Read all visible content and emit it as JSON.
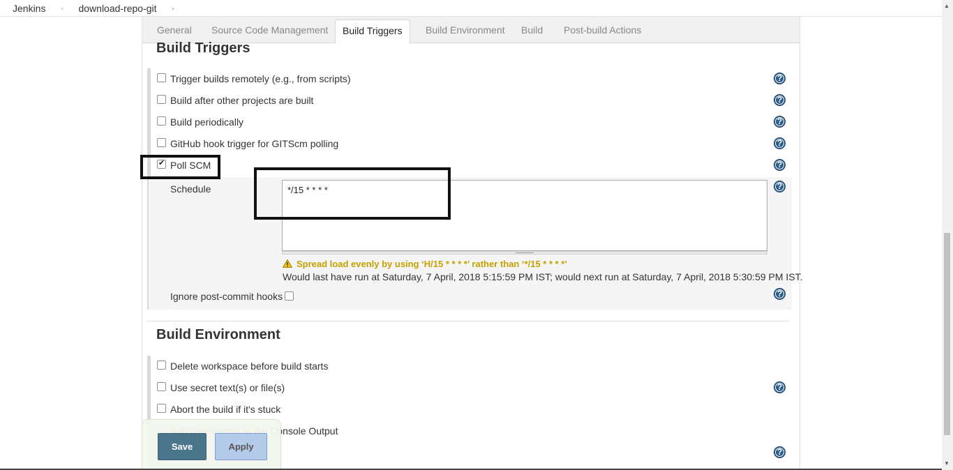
{
  "breadcrumb": {
    "items": [
      "Jenkins",
      "download-repo-git"
    ],
    "separator": "›"
  },
  "tabs": [
    {
      "label": "General",
      "active": false
    },
    {
      "label": "Source Code Management",
      "active": false
    },
    {
      "label": "Build Triggers",
      "active": true
    },
    {
      "label": "Build Environment",
      "active": false
    },
    {
      "label": "Build",
      "active": false
    },
    {
      "label": "Post-build Actions",
      "active": false
    }
  ],
  "build_triggers": {
    "title": "Build Triggers",
    "options": [
      {
        "label": "Trigger builds remotely (e.g., from scripts)",
        "checked": false,
        "help": true
      },
      {
        "label": "Build after other projects are built",
        "checked": false,
        "help": true
      },
      {
        "label": "Build periodically",
        "checked": false,
        "help": true
      },
      {
        "label": "GitHub hook trigger for GITScm polling",
        "checked": false,
        "help": true
      },
      {
        "label": "Poll SCM",
        "checked": true,
        "help": true
      }
    ],
    "schedule": {
      "label": "Schedule",
      "value": "*/15 * * * *",
      "warning": "Spread load evenly by using ‘H/15 * * * *’ rather than ‘*/15 * * * *’",
      "info": "Would last have run at Saturday, 7 April, 2018 5:15:59 PM IST; would next run at Saturday, 7 April, 2018 5:30:59 PM IST."
    },
    "ignore_post_commit": {
      "label": "Ignore post-commit hooks",
      "checked": false
    }
  },
  "build_environment": {
    "title": "Build Environment",
    "options": [
      {
        "label": "Delete workspace before build starts",
        "checked": false
      },
      {
        "label": "Use secret text(s) or file(s)",
        "checked": false
      },
      {
        "label": "Abort the build if it's stuck",
        "checked": false
      },
      {
        "label": "Add timestamps to the Console Output",
        "checked": false
      }
    ]
  },
  "buttons": {
    "save": "Save",
    "apply": "Apply"
  },
  "help_icon": "?",
  "colors": {
    "save_button": "#4b758b",
    "apply_button": "#b4cce9",
    "help_icon": "#2c5c8a",
    "warning_text": "#c4a000"
  }
}
